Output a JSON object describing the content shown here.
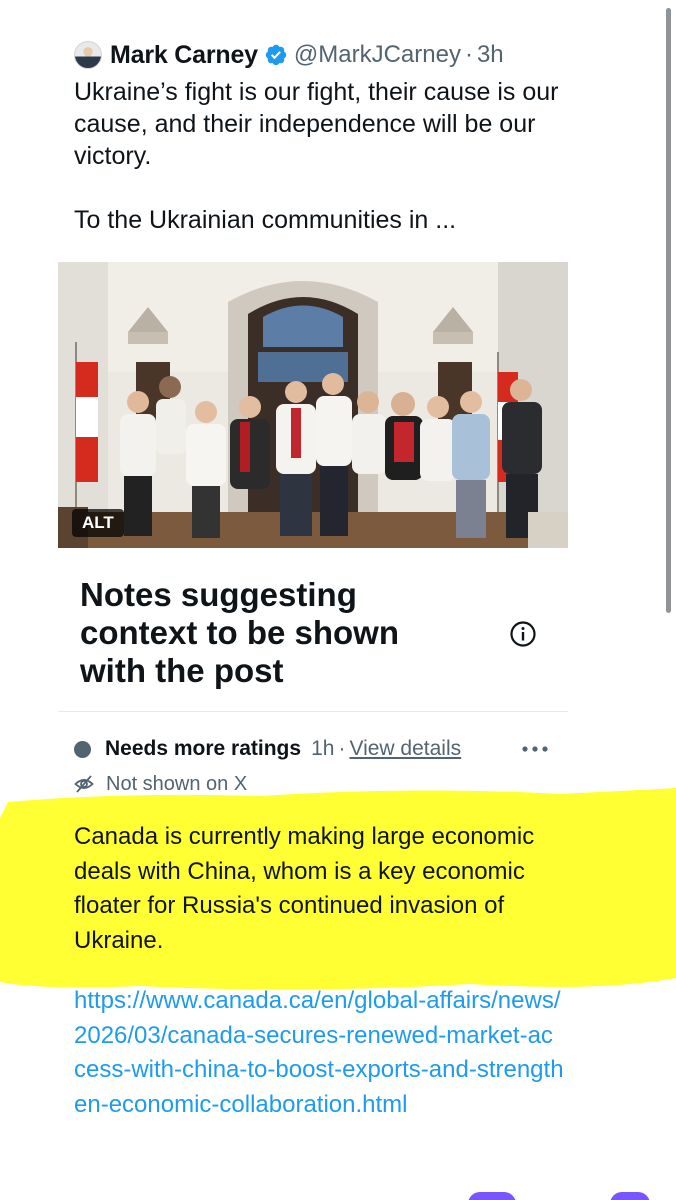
{
  "tweet": {
    "author_name": "Mark Carney",
    "verified": true,
    "handle": "@MarkJCarney",
    "separator": "·",
    "timestamp": "3h",
    "text_line1": "Ukraine’s fight is our fight, their cause is our cause, and their independence will be our victory.",
    "text_line2": "To the Ukrainian communities in ...",
    "photo_alt_badge": "ALT",
    "icons": {
      "avatar": "profile-avatar",
      "verified": "verified-badge-icon"
    },
    "colors": {
      "verified": "#1d9bf0",
      "secondary_text": "#536471"
    }
  },
  "notes_panel": {
    "title": "Notes suggesting context to be shown with the post",
    "info_icon": "info-icon"
  },
  "note": {
    "status": "Needs more ratings",
    "age": "1h",
    "separator": "·",
    "view_details": "View details",
    "more_icon": "more-horizontal-icon",
    "visibility": "Not shown on X",
    "visibility_icon": "eye-off-icon",
    "body": "Canada is currently making large economic deals with China, whom is a key economic floater for Russia's continued invasion of Ukraine.",
    "link": "https://www.canada.ca/en/global-affairs/news/2026/03/canada-secures-renewed-market-access-with-china-to-boost-exports-and-strengthen-economic-collaboration.html",
    "colors": {
      "link": "#1d9bf0",
      "highlight": "#ffff33",
      "status_dot": "#536471"
    }
  }
}
